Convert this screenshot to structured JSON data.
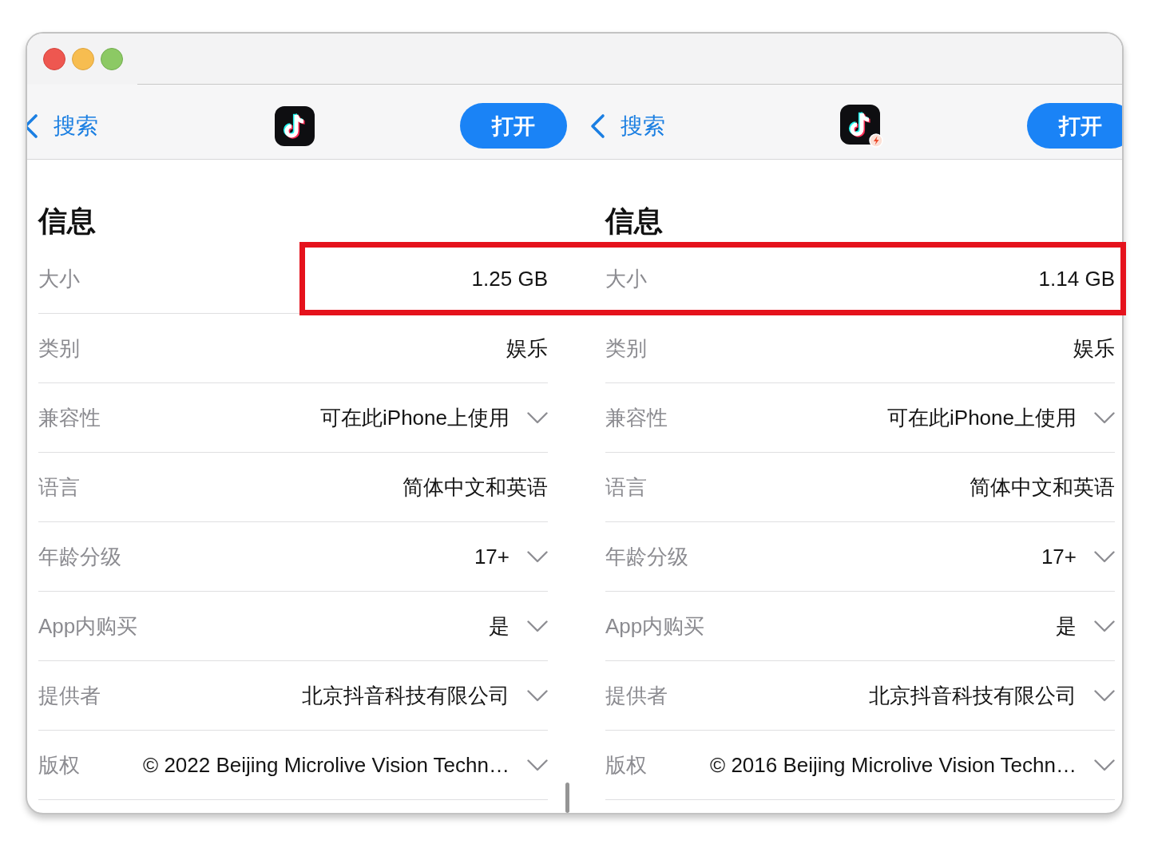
{
  "panels": [
    {
      "nav": {
        "back": "搜索",
        "open_button": "打开",
        "app_icon": {
          "badge": false
        }
      },
      "section_title": "信息",
      "scrollbar": true,
      "rows": [
        {
          "label": "大小",
          "value": "1.25 GB",
          "expandable": false,
          "highlighted": true
        },
        {
          "label": "类别",
          "value": "娱乐",
          "expandable": false,
          "highlighted": false
        },
        {
          "label": "兼容性",
          "value": "可在此iPhone上使用",
          "expandable": true,
          "highlighted": false
        },
        {
          "label": "语言",
          "value": "简体中文和英语",
          "expandable": false,
          "highlighted": false
        },
        {
          "label": "年龄分级",
          "value": "17+",
          "expandable": true,
          "highlighted": false
        },
        {
          "label": "App内购买",
          "value": "是",
          "expandable": true,
          "highlighted": false
        },
        {
          "label": "提供者",
          "value": "北京抖音科技有限公司",
          "expandable": true,
          "highlighted": false
        },
        {
          "label": "版权",
          "value": "© 2022 Beijing Microlive Vision Techn…",
          "expandable": true,
          "highlighted": false
        }
      ]
    },
    {
      "nav": {
        "back": "搜索",
        "open_button": "打开",
        "app_icon": {
          "badge": true
        }
      },
      "section_title": "信息",
      "rows": [
        {
          "label": "大小",
          "value": "1.14 GB",
          "expandable": false,
          "highlighted": true
        },
        {
          "label": "类别",
          "value": "娱乐",
          "expandable": false,
          "highlighted": false
        },
        {
          "label": "兼容性",
          "value": "可在此iPhone上使用",
          "expandable": true,
          "highlighted": false
        },
        {
          "label": "语言",
          "value": "简体中文和英语",
          "expandable": false,
          "highlighted": false
        },
        {
          "label": "年龄分级",
          "value": "17+",
          "expandable": true,
          "highlighted": false
        },
        {
          "label": "App内购买",
          "value": "是",
          "expandable": true,
          "highlighted": false
        },
        {
          "label": "提供者",
          "value": "北京抖音科技有限公司",
          "expandable": true,
          "highlighted": false
        },
        {
          "label": "版权",
          "value": "© 2016 Beijing Microlive Vision Techn…",
          "expandable": true,
          "highlighted": false
        }
      ]
    }
  ]
}
